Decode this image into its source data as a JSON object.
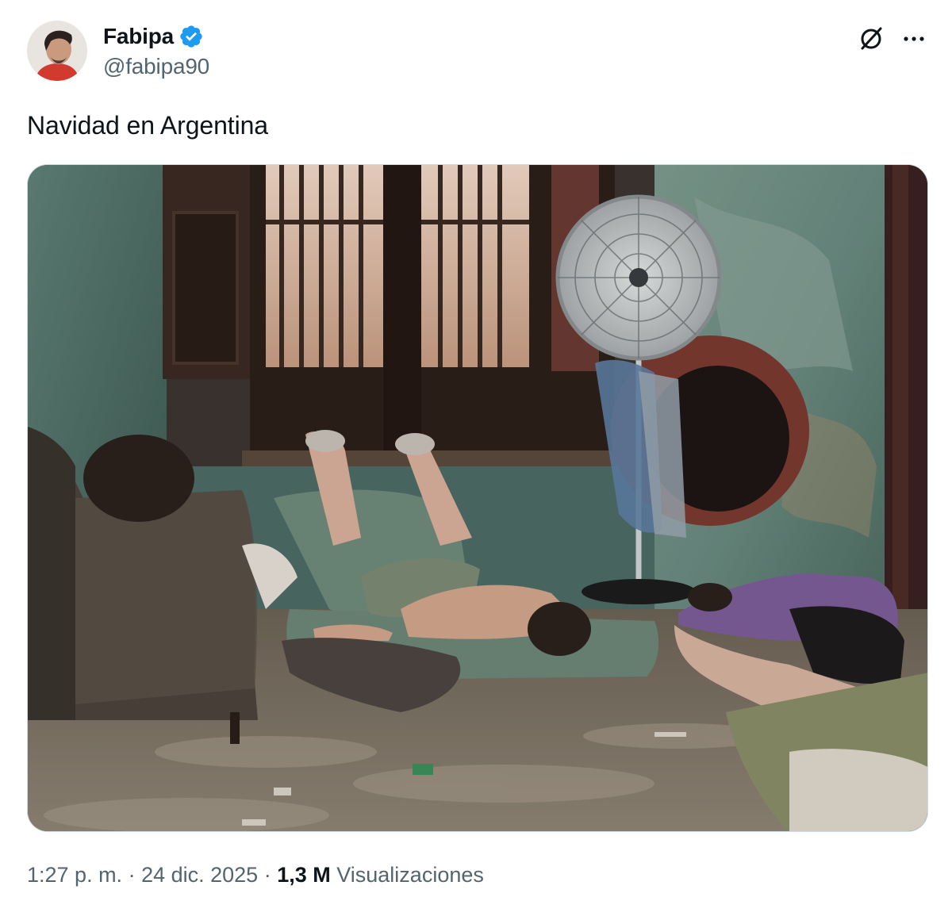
{
  "author": {
    "display_name": "Fabipa",
    "handle": "@fabipa90",
    "verified": true,
    "avatar_icon": "profile-photo-avatar"
  },
  "header_actions": {
    "grok_icon": "grok-icon",
    "more_icon": "more-options-icon"
  },
  "tweet": {
    "text": "Navidad en Argentina",
    "media_icon": "photo-room-with-fan"
  },
  "meta": {
    "time": "1:27 p. m.",
    "separator": " · ",
    "date": "24 dic. 2025",
    "views_count": "1,3 M",
    "views_label": "Visualizaciones"
  },
  "colors": {
    "text_primary": "#0f1419",
    "text_secondary": "#536471",
    "verified_blue": "#1d9bf0",
    "border": "#cfd9de"
  }
}
